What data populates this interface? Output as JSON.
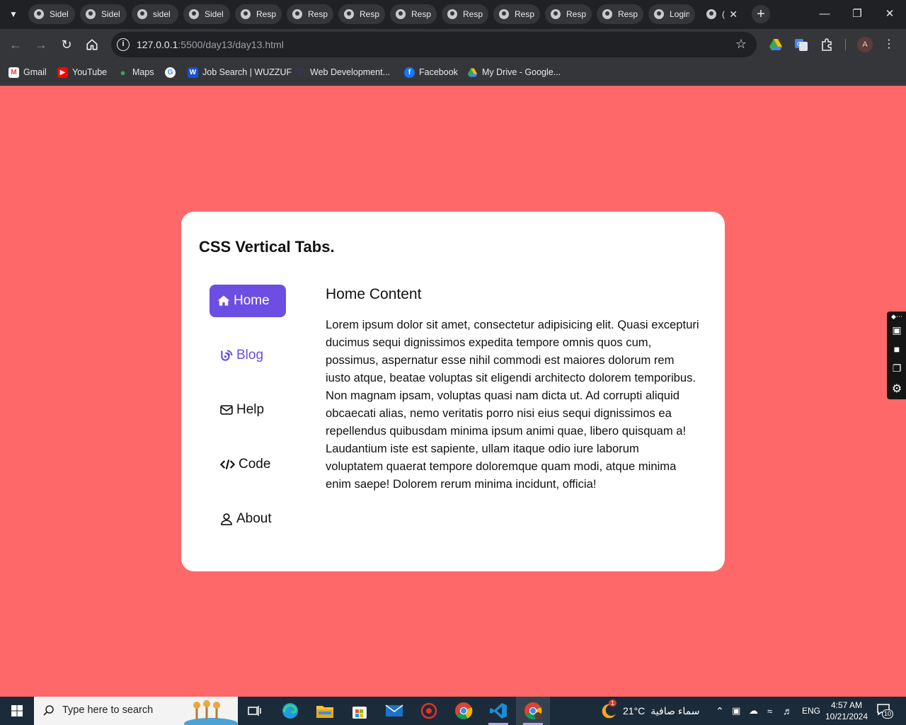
{
  "browser": {
    "tabs": [
      {
        "title": "Sidel"
      },
      {
        "title": "Sidel"
      },
      {
        "title": "sidel"
      },
      {
        "title": "Sidel"
      },
      {
        "title": "Resp"
      },
      {
        "title": "Resp"
      },
      {
        "title": "Resp"
      },
      {
        "title": "Resp"
      },
      {
        "title": "Resp"
      },
      {
        "title": "Resp"
      },
      {
        "title": "Resp"
      },
      {
        "title": "Resp"
      },
      {
        "title": "Login"
      },
      {
        "title": "("
      }
    ],
    "url_host": "127.0.0.1",
    "url_path": ":5500/day13/day13.html",
    "profile_initial": "A",
    "bookmarks": [
      {
        "label": "Gmail",
        "icon": "gmail-icon",
        "color": "#ea4335"
      },
      {
        "label": "YouTube",
        "icon": "youtube-icon",
        "color": "#ff0000"
      },
      {
        "label": "Maps",
        "icon": "maps-icon",
        "color": "#34a853"
      },
      {
        "label": "",
        "icon": "google-icon",
        "color": "#4285f4"
      },
      {
        "label": "Job Search | WUZZUF",
        "icon": "wuzzuf-icon",
        "color": "#1a4fd6"
      },
      {
        "label": "Web Development...",
        "icon": "web-dev-icon",
        "color": "#3b3bd6"
      },
      {
        "label": "Facebook",
        "icon": "facebook-icon",
        "color": "#1877f2"
      },
      {
        "label": "My Drive - Google...",
        "icon": "drive-icon",
        "color": "#fbbc04"
      }
    ]
  },
  "page": {
    "title": "CSS Vertical Tabs.",
    "tabs": [
      {
        "label": "Home",
        "icon": "home-icon"
      },
      {
        "label": "Blog",
        "icon": "blog-icon"
      },
      {
        "label": "Help",
        "icon": "envelope-icon"
      },
      {
        "label": "Code",
        "icon": "code-icon"
      },
      {
        "label": "About",
        "icon": "user-icon"
      }
    ],
    "active_tab": "Home",
    "content_title": "Home Content",
    "content_body": "Lorem ipsum dolor sit amet, consectetur adipisicing elit. Quasi excepturi ducimus sequi dignissimos expedita tempore omnis quos cum, possimus, aspernatur esse nihil commodi est maiores dolorum rem iusto atque, beatae voluptas sit eligendi architecto dolorem temporibus. Non magnam ipsam, voluptas quasi nam dicta ut. Ad corrupti aliquid obcaecati alias, nemo veritatis porro nisi eius sequi dignissimos ea repellendus quibusdam minima ipsum animi quae, libero quisquam a! Laudantium iste est sapiente, ullam itaque odio iure laborum voluptatem quaerat tempore doloremque quam modi, atque minima enim saepe! Dolorem rerum minima incidunt, officia!",
    "colors": {
      "background": "#ff6868",
      "accent": "#6c4ee3",
      "card": "#ffffff"
    }
  },
  "taskbar": {
    "search_placeholder": "Type here to search",
    "weather_temp": "21°C",
    "weather_desc": "سماء صافية",
    "weather_badge": "1",
    "language": "ENG",
    "time": "4:57 AM",
    "date": "10/21/2024",
    "notifications": "10"
  }
}
